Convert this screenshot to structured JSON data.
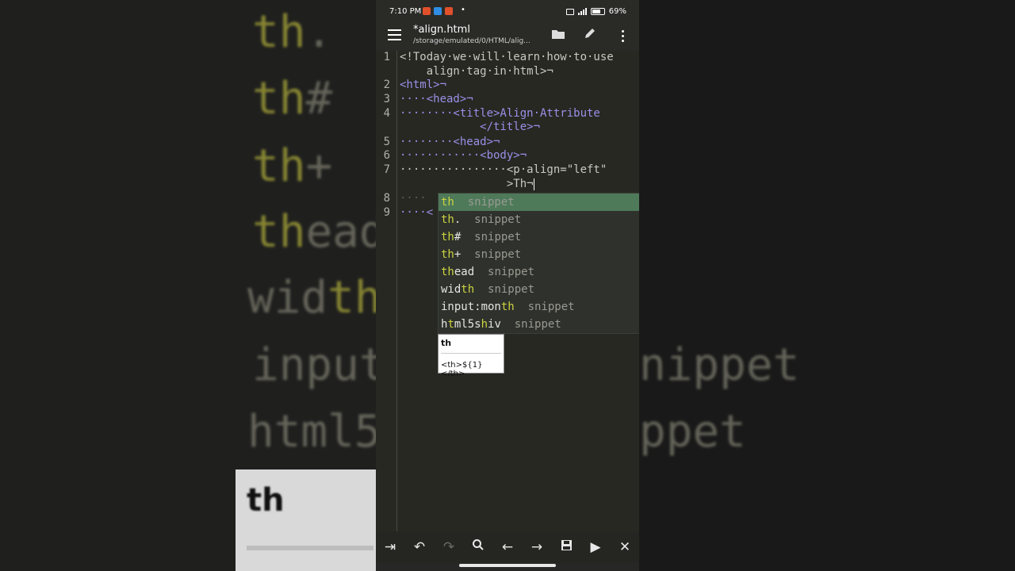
{
  "background": {
    "words": [
      {
        "match": "th",
        "rest": "."
      },
      {
        "match": "th",
        "rest": "#"
      },
      {
        "match": "th",
        "rest": "+"
      },
      {
        "match": "th",
        "rest": "ead"
      },
      {
        "pre": "wid",
        "match": "th",
        "rest": ""
      },
      {
        "pre": "input",
        "match": "",
        "rest": ""
      },
      {
        "pre": "html5",
        "match": "",
        "rest": ""
      }
    ],
    "right_words": [
      "nippet",
      "ppet"
    ],
    "tip_text": "th"
  },
  "status_bar": {
    "time": "7:10 PM",
    "battery": "69%",
    "dot": "•"
  },
  "toolbar": {
    "title": "*align.html",
    "path": "/storage/emulated/0/HTML/alig...",
    "menu_icon": "hamburger-icon",
    "open_icon": "folder-icon",
    "edit_icon": "pencil-icon",
    "more_icon": "kebab-icon"
  },
  "editor": {
    "lines": [
      {
        "num": "1",
        "rows": [
          "<!Today·we·will·learn·how·to·use",
          "    align·tag·in·html>¬"
        ]
      },
      {
        "num": "2",
        "rows": [
          "<html>¬"
        ]
      },
      {
        "num": "3",
        "rows": [
          "····<head>¬"
        ]
      },
      {
        "num": "4",
        "rows": [
          "········<title>Align·Attribute",
          "            </title>¬"
        ]
      },
      {
        "num": "5",
        "rows": [
          "········<head>¬"
        ]
      },
      {
        "num": "6",
        "rows": [
          "············<body>¬"
        ]
      },
      {
        "num": "7",
        "rows": [
          "················<p·align=\"left\"",
          "                >Th¬"
        ]
      },
      {
        "num": "8",
        "rows": [
          "····"
        ]
      },
      {
        "num": "9",
        "rows": [
          "····<"
        ]
      }
    ]
  },
  "autocomplete": {
    "kind_label": "snippet",
    "items": [
      {
        "pre": "",
        "match": "th",
        "post": ""
      },
      {
        "pre": "",
        "match": "th",
        "post": "."
      },
      {
        "pre": "",
        "match": "th",
        "post": "#"
      },
      {
        "pre": "",
        "match": "th",
        "post": "+"
      },
      {
        "pre": "",
        "match": "th",
        "post": "ead"
      },
      {
        "pre": "wid",
        "match": "th",
        "post": ""
      },
      {
        "pre": "input:mon",
        "match": "th",
        "post": ""
      },
      {
        "pre": "h",
        "match": "t",
        "post": "ml5s",
        "match2": "h",
        "post2": "iv"
      }
    ],
    "tooltip": {
      "name": "th",
      "snippet": "<th>${1}</th>"
    }
  },
  "bottom_bar": {
    "icons": [
      "tab-indent-icon",
      "undo-icon",
      "redo-icon",
      "search-icon",
      "arrow-left-icon",
      "arrow-right-icon",
      "save-icon",
      "run-icon",
      "close-icon"
    ]
  }
}
